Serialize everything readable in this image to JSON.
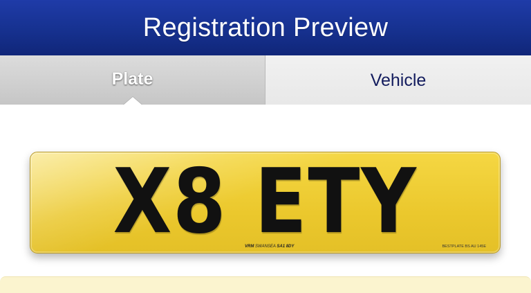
{
  "header": {
    "title": "Registration Preview"
  },
  "tabs": [
    {
      "label": "Plate",
      "selected": true
    },
    {
      "label": "Vehicle",
      "selected": false
    }
  ],
  "plate": {
    "registration": "X8 ETY",
    "dealer_prefix": "VRM",
    "dealer_text": "SWANSEA",
    "dealer_postcode": "SA1 8DY",
    "standard_text": "BESTPLATE BS AU 145E"
  },
  "colors": {
    "header": "#16318f",
    "plate_yellow": "#ebc82d",
    "selected_tab": "#c6c6c6",
    "unselected_tab": "#ececec",
    "vehicle_tab_text": "#131c5e",
    "info_panel": "#fbf4cf"
  }
}
